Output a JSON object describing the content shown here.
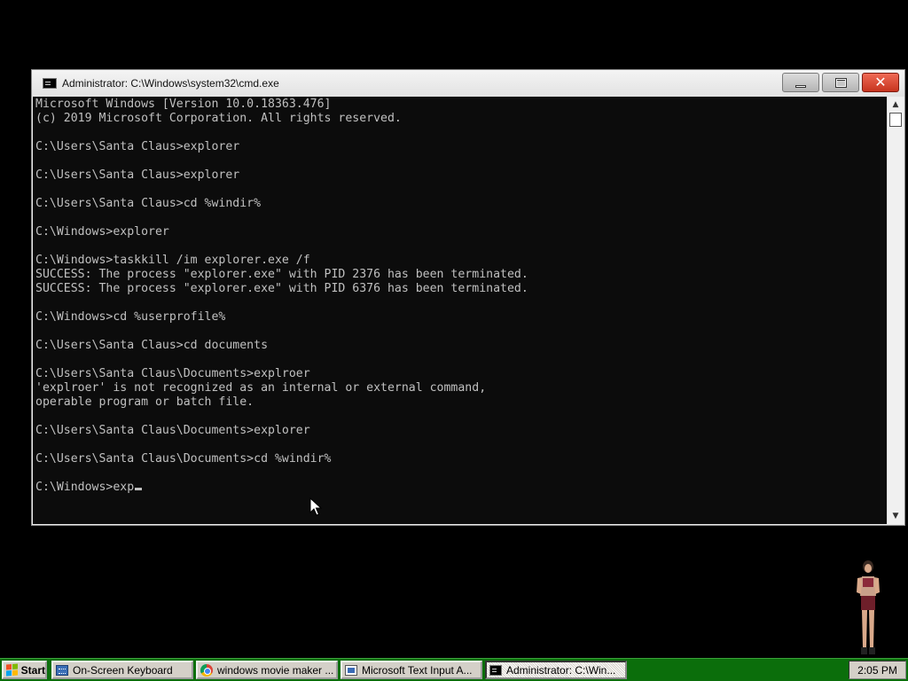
{
  "window": {
    "title": "Administrator: C:\\Windows\\system32\\cmd.exe",
    "icon": "cmd-icon",
    "controls": {
      "minimize": "minimize-icon",
      "maximize": "maximize-icon",
      "close": "close-icon"
    }
  },
  "console": {
    "lines": [
      "Microsoft Windows [Version 10.0.18363.476]",
      "(c) 2019 Microsoft Corporation. All rights reserved.",
      "",
      "C:\\Users\\Santa Claus>explorer",
      "",
      "C:\\Users\\Santa Claus>explorer",
      "",
      "C:\\Users\\Santa Claus>cd %windir%",
      "",
      "C:\\Windows>explorer",
      "",
      "C:\\Windows>taskkill /im explorer.exe /f",
      "SUCCESS: The process \"explorer.exe\" with PID 2376 has been terminated.",
      "SUCCESS: The process \"explorer.exe\" with PID 6376 has been terminated.",
      "",
      "C:\\Windows>cd %userprofile%",
      "",
      "C:\\Users\\Santa Claus>cd documents",
      "",
      "C:\\Users\\Santa Claus\\Documents>explroer",
      "'explroer' is not recognized as an internal or external command,",
      "operable program or batch file.",
      "",
      "C:\\Users\\Santa Claus\\Documents>explorer",
      "",
      "C:\\Users\\Santa Claus\\Documents>cd %windir%",
      ""
    ],
    "current_prompt": "C:\\Windows>exp",
    "text_color": "#c0c0c0",
    "background": "#0c0c0c"
  },
  "taskbar": {
    "start_label": "Start",
    "buttons": [
      {
        "label": "On-Screen Keyboard",
        "icon": "keyboard-icon"
      },
      {
        "label": "windows movie maker ...",
        "icon": "chrome-icon"
      },
      {
        "label": "Microsoft Text Input A...",
        "icon": "text-input-icon"
      },
      {
        "label": "Administrator: C:\\Win...",
        "icon": "cmd-icon",
        "active": true
      }
    ],
    "clock": "2:05 PM",
    "color": "#0b6e0b"
  }
}
